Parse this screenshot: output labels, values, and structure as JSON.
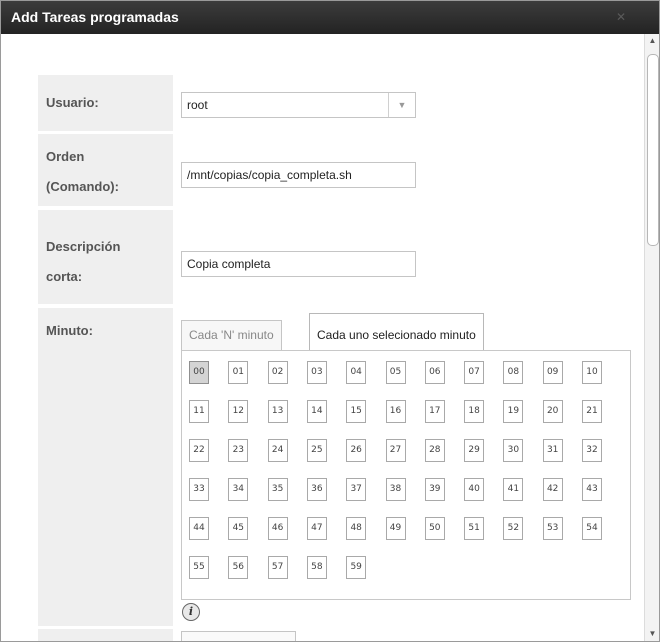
{
  "window": {
    "title": "Add Tareas programadas"
  },
  "form": {
    "usuario": {
      "label": "Usuario:",
      "value": "root"
    },
    "orden": {
      "label_line1": "Orden",
      "label_line2": "(Comando):",
      "value": "/mnt/copias/copia_completa.sh"
    },
    "descripcion": {
      "label_line1": "Descripción",
      "label_line2": "corta:",
      "value": "Copia completa"
    },
    "minuto": {
      "label": "Minuto:",
      "tabs": [
        "Cada 'N' minuto",
        "Cada uno selecionado minuto"
      ],
      "active_tab": 1,
      "selected": [
        "00"
      ],
      "values": [
        "00",
        "01",
        "02",
        "03",
        "04",
        "05",
        "06",
        "07",
        "08",
        "09",
        "10",
        "11",
        "12",
        "13",
        "14",
        "15",
        "16",
        "17",
        "18",
        "19",
        "20",
        "21",
        "22",
        "23",
        "24",
        "25",
        "26",
        "27",
        "28",
        "29",
        "30",
        "31",
        "32",
        "33",
        "34",
        "35",
        "36",
        "37",
        "38",
        "39",
        "40",
        "41",
        "42",
        "43",
        "44",
        "45",
        "46",
        "47",
        "48",
        "49",
        "50",
        "51",
        "52",
        "53",
        "54",
        "55",
        "56",
        "57",
        "58",
        "59"
      ]
    }
  },
  "icons": {
    "close": "close-icon",
    "info": "info-icon",
    "dropdown": "chevron-down-icon"
  }
}
